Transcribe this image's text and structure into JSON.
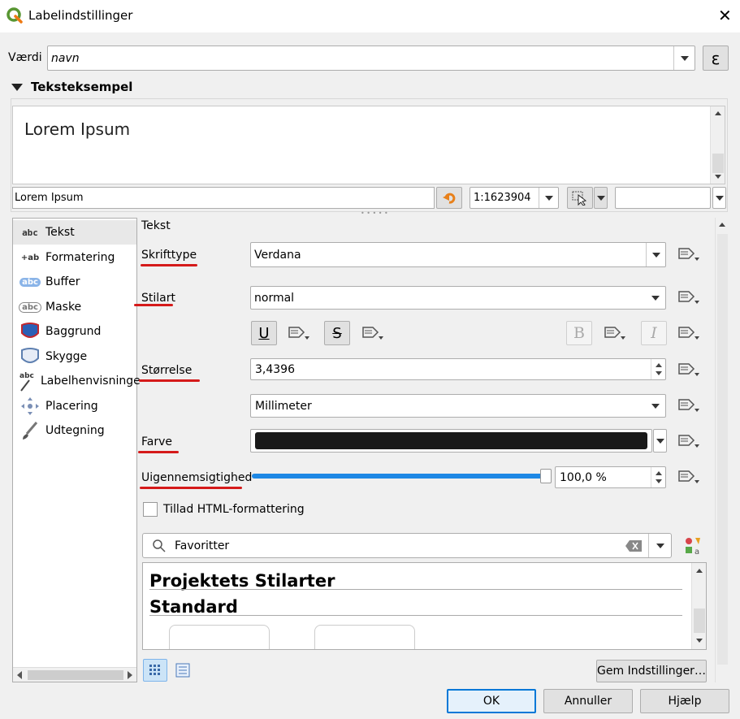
{
  "window": {
    "title": "Labelindstillinger",
    "close": "✕"
  },
  "value_row": {
    "label": "Værdi",
    "value": "navn",
    "expr_btn": "ε"
  },
  "sample": {
    "section_title": "Teksteksempel",
    "preview_text": "Lorem Ipsum",
    "input_value": "Lorem Ipsum",
    "scale": "1:1623904"
  },
  "sidebar": {
    "items": [
      {
        "icon": "abc",
        "label": "Tekst"
      },
      {
        "icon": "+ab",
        "label": "Formatering"
      },
      {
        "icon": "abc",
        "label": "Buffer"
      },
      {
        "icon": "abc",
        "label": "Maske"
      },
      {
        "icon": "",
        "label": "Baggrund"
      },
      {
        "icon": "",
        "label": "Skygge"
      },
      {
        "icon": "abc",
        "label": "Labelhenvisninge"
      },
      {
        "icon": "",
        "label": "Placering"
      },
      {
        "icon": "",
        "label": "Udtegning"
      }
    ]
  },
  "text_panel": {
    "title": "Tekst",
    "font_label": "Skrifttype",
    "font_value": "Verdana",
    "style_label": "Stilart",
    "style_value": "normal",
    "underline": "U",
    "strike": "S",
    "bold": "B",
    "italic": "I",
    "size_label": "Størrelse",
    "size_value": "3,4396",
    "unit_value": "Millimeter",
    "color_label": "Farve",
    "color_value": "#1a1a1a",
    "opacity_label": "Uigennemsigtighed",
    "opacity_value": "100,0 %",
    "opacity_level": 1.0,
    "html_label": "Tillad HTML-formattering",
    "html_checked": false
  },
  "styles": {
    "search_placeholder": "Favoritter",
    "groups": [
      "Projektets Stilarter",
      "Standard"
    ],
    "save_btn": "Gem Indstillinger…"
  },
  "footer": {
    "ok": "OK",
    "cancel": "Annuller",
    "help": "Hjælp"
  },
  "colors": {
    "accent": "#1e88e5",
    "underline_red": "#d51a1a",
    "qgis_green": "#589632"
  }
}
